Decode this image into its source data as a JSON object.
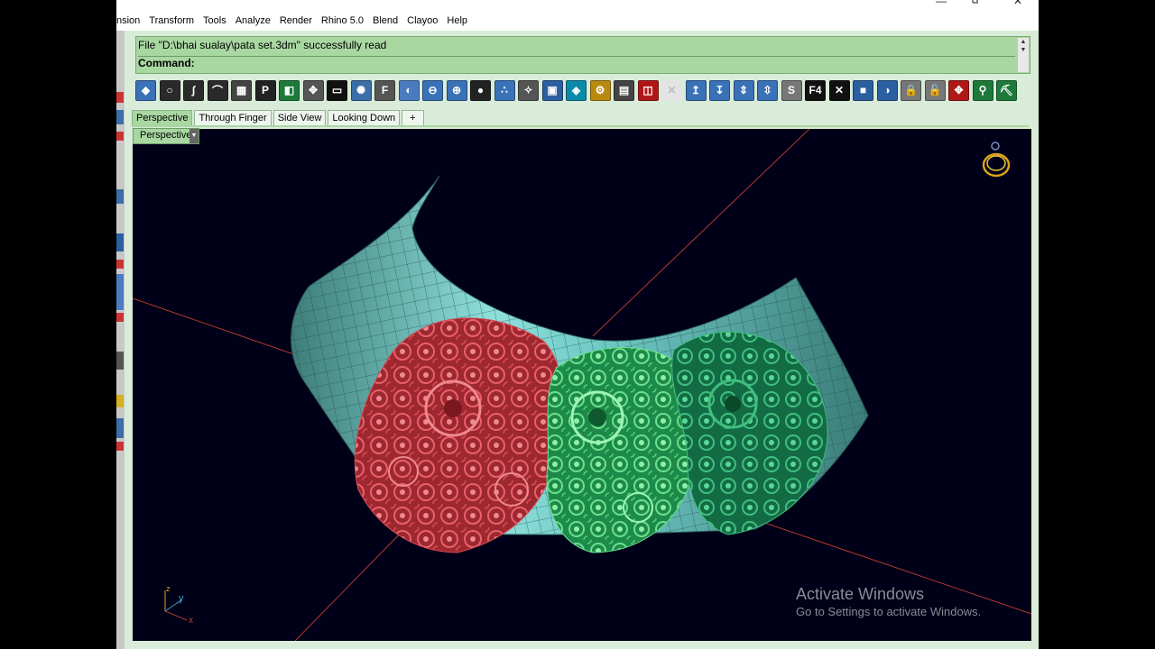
{
  "menu": [
    "nsion",
    "Transform",
    "Tools",
    "Analyze",
    "Render",
    "Rhino 5.0",
    "Blend",
    "Clayoo",
    "Help"
  ],
  "window_controls": {
    "minimize": "—",
    "maximize": "⧉",
    "close": "✕"
  },
  "command": {
    "history": "File \"D:\\bhai sualay\\pata set.3dm\" successfully read",
    "prompt": "Command:",
    "scroll_up": "▲",
    "scroll_down": "▼"
  },
  "toolbar": {
    "icons": [
      {
        "name": "select-points-icon",
        "glyph": "◆",
        "color": "#3a72b8"
      },
      {
        "name": "circle-icon",
        "glyph": "○",
        "color": "#2a2a2a"
      },
      {
        "name": "curve-icon",
        "glyph": "∫",
        "color": "#2a2a2a"
      },
      {
        "name": "pipe-icon",
        "glyph": "⌒",
        "color": "#2a2a2a"
      },
      {
        "name": "array-icon",
        "glyph": "▦",
        "color": "#444"
      },
      {
        "name": "properties-icon",
        "glyph": "P",
        "color": "#222"
      },
      {
        "name": "surface-icon",
        "glyph": "◧",
        "color": "#1e7a3a"
      },
      {
        "name": "gumball-icon",
        "glyph": "✥",
        "color": "#555"
      },
      {
        "name": "monitor-icon",
        "glyph": "▭",
        "color": "#111"
      },
      {
        "name": "gear-sphere-icon",
        "glyph": "✺",
        "color": "#3b6ea8"
      },
      {
        "name": "text-fe-icon",
        "glyph": "F",
        "color": "#555"
      },
      {
        "name": "mirror-icon",
        "glyph": "◐",
        "color": "#4b7bbf"
      },
      {
        "name": "section-icon",
        "glyph": "⊖",
        "color": "#3a72b8"
      },
      {
        "name": "grid-sphere-icon",
        "glyph": "⊕",
        "color": "#3a72b8"
      },
      {
        "name": "blobs-icon",
        "glyph": "●",
        "color": "#222"
      },
      {
        "name": "dots-icon",
        "glyph": "∴",
        "color": "#3a72b8"
      },
      {
        "name": "pattern-icon",
        "glyph": "✧",
        "color": "#555"
      },
      {
        "name": "save-icon",
        "glyph": "▣",
        "color": "#2a5fa0"
      },
      {
        "name": "cube-icon",
        "glyph": "◈",
        "color": "#0a8aa8"
      },
      {
        "name": "gear-icon",
        "glyph": "⚙",
        "color": "#b88a10"
      },
      {
        "name": "layout-icon",
        "glyph": "▤",
        "color": "#444"
      },
      {
        "name": "film-icon",
        "glyph": "◫",
        "color": "#b01818"
      },
      {
        "name": "disabled-x-icon",
        "glyph": "✕",
        "color": "#bdbdbd"
      },
      {
        "name": "arrow-up-icon",
        "glyph": "↥",
        "color": "#3a72b8"
      },
      {
        "name": "arrow-down-icon",
        "glyph": "↧",
        "color": "#3a72b8"
      },
      {
        "name": "arrows-vertical-icon",
        "glyph": "⇕",
        "color": "#3a72b8"
      },
      {
        "name": "arrows-spread-icon",
        "glyph": "⇳",
        "color": "#3a72b8"
      },
      {
        "name": "s-tool-icon",
        "glyph": "S",
        "color": "#777"
      },
      {
        "name": "f4-icon",
        "glyph": "F4",
        "color": "#111"
      },
      {
        "name": "cross-box-icon",
        "glyph": "✕",
        "color": "#111"
      },
      {
        "name": "shade-cube-icon",
        "glyph": "■",
        "color": "#2a5fa0"
      },
      {
        "name": "shade-half-icon",
        "glyph": "◑",
        "color": "#2a5fa0"
      },
      {
        "name": "lock-icon",
        "glyph": "🔒",
        "color": "#777"
      },
      {
        "name": "unlock-icon",
        "glyph": "🔓",
        "color": "#777"
      },
      {
        "name": "transform-icon",
        "glyph": "✥",
        "color": "#b01818"
      },
      {
        "name": "pin-icon",
        "glyph": "⚲",
        "color": "#1e7a3a"
      },
      {
        "name": "worker-icon",
        "glyph": "⛏",
        "color": "#1e7a3a"
      }
    ]
  },
  "tabs": [
    {
      "label": "Perspective",
      "active": true
    },
    {
      "label": "Through Finger",
      "active": false
    },
    {
      "label": "Side View",
      "active": false
    },
    {
      "label": "Looking Down",
      "active": false
    },
    {
      "label": "+",
      "active": false
    }
  ],
  "viewport": {
    "title": "Perspective",
    "dropdown": "▼",
    "axis_x": "x",
    "axis_y": "y",
    "axis_z": "z",
    "background": "#000018"
  },
  "watermark": {
    "line1": "Activate Windows",
    "line2": "Go to Settings to activate Windows."
  },
  "colors": {
    "accent_green": "#a9d7a2",
    "jewel_red": "#c0303a",
    "jewel_green": "#2cb060",
    "surface_teal": "#5aa9a4"
  }
}
